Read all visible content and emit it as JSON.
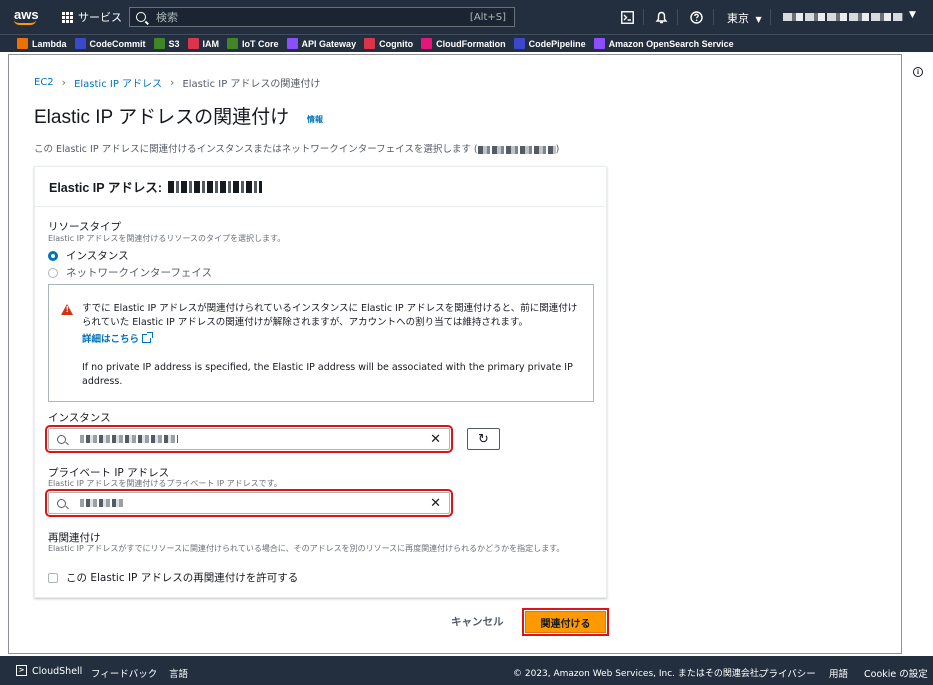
{
  "topnav": {
    "logo": "aws",
    "services_label": "サービス",
    "search_placeholder": "検索",
    "search_shortcut": "[Alt+S]",
    "region": "東京",
    "icons": [
      "cloudshell-icon",
      "bell-icon",
      "help-icon"
    ]
  },
  "favorites": [
    {
      "label": "Lambda",
      "color": "#ed7100"
    },
    {
      "label": "CodeCommit",
      "color": "#3b48cc"
    },
    {
      "label": "S3",
      "color": "#3f8624"
    },
    {
      "label": "IAM",
      "color": "#dd344c"
    },
    {
      "label": "IoT Core",
      "color": "#3f8624"
    },
    {
      "label": "API Gateway",
      "color": "#8c4fff"
    },
    {
      "label": "Cognito",
      "color": "#dd344c"
    },
    {
      "label": "CloudFormation",
      "color": "#e7157b"
    },
    {
      "label": "CodePipeline",
      "color": "#3b48cc"
    },
    {
      "label": "Amazon OpenSearch Service",
      "color": "#8c4fff"
    }
  ],
  "breadcrumb": {
    "items": [
      "EC2",
      "Elastic IP アドレス",
      "Elastic IP アドレスの関連付け"
    ]
  },
  "page": {
    "title": "Elastic IP アドレスの関連付け",
    "info_link": "情報",
    "subtitle": "この Elastic IP アドレスに関連付けるインスタンスまたはネットワークインターフェイスを選択します ("
  },
  "card": {
    "header": "Elastic IP アドレス:",
    "resource_type": {
      "label": "リソースタイプ",
      "description": "Elastic IP アドレスを関連付けるリソースのタイプを選択します。",
      "options": [
        "インスタンス",
        "ネットワークインターフェイス"
      ],
      "selected": "インスタンス"
    },
    "alert": {
      "text": "すでに Elastic IP アドレスが関連付けられているインスタンスに Elastic IP アドレスを関連付けると、前に関連付けられていた Elastic IP アドレスの関連付けが解除されますが、アカウントへの割り当ては維持されます。",
      "link": "詳細はこちら",
      "note": "If no private IP address is specified, the Elastic IP address will be associated with the primary private IP address."
    },
    "instance": {
      "label": "インスタンス"
    },
    "private_ip": {
      "label": "プライベート IP アドレス",
      "description": "Elastic IP アドレスを関連付けるプライベート IP アドレスです。"
    },
    "reassociation": {
      "label": "再関連付け",
      "description": "Elastic IP アドレスがすでにリソースに関連付けられている場合に、そのアドレスを別のリソースに再度関連付けられるかどうかを指定します。",
      "checkbox_label": "この Elastic IP アドレスの再関連付けを許可する"
    }
  },
  "actions": {
    "cancel": "キャンセル",
    "submit": "関連付ける"
  },
  "footer": {
    "cloudshell": "CloudShell",
    "feedback": "フィードバック",
    "language": "言語",
    "copyright": "© 2023, Amazon Web Services, Inc. またはその関連会社。",
    "privacy": "プライバシー",
    "terms": "用語",
    "cookie": "Cookie の設定"
  }
}
